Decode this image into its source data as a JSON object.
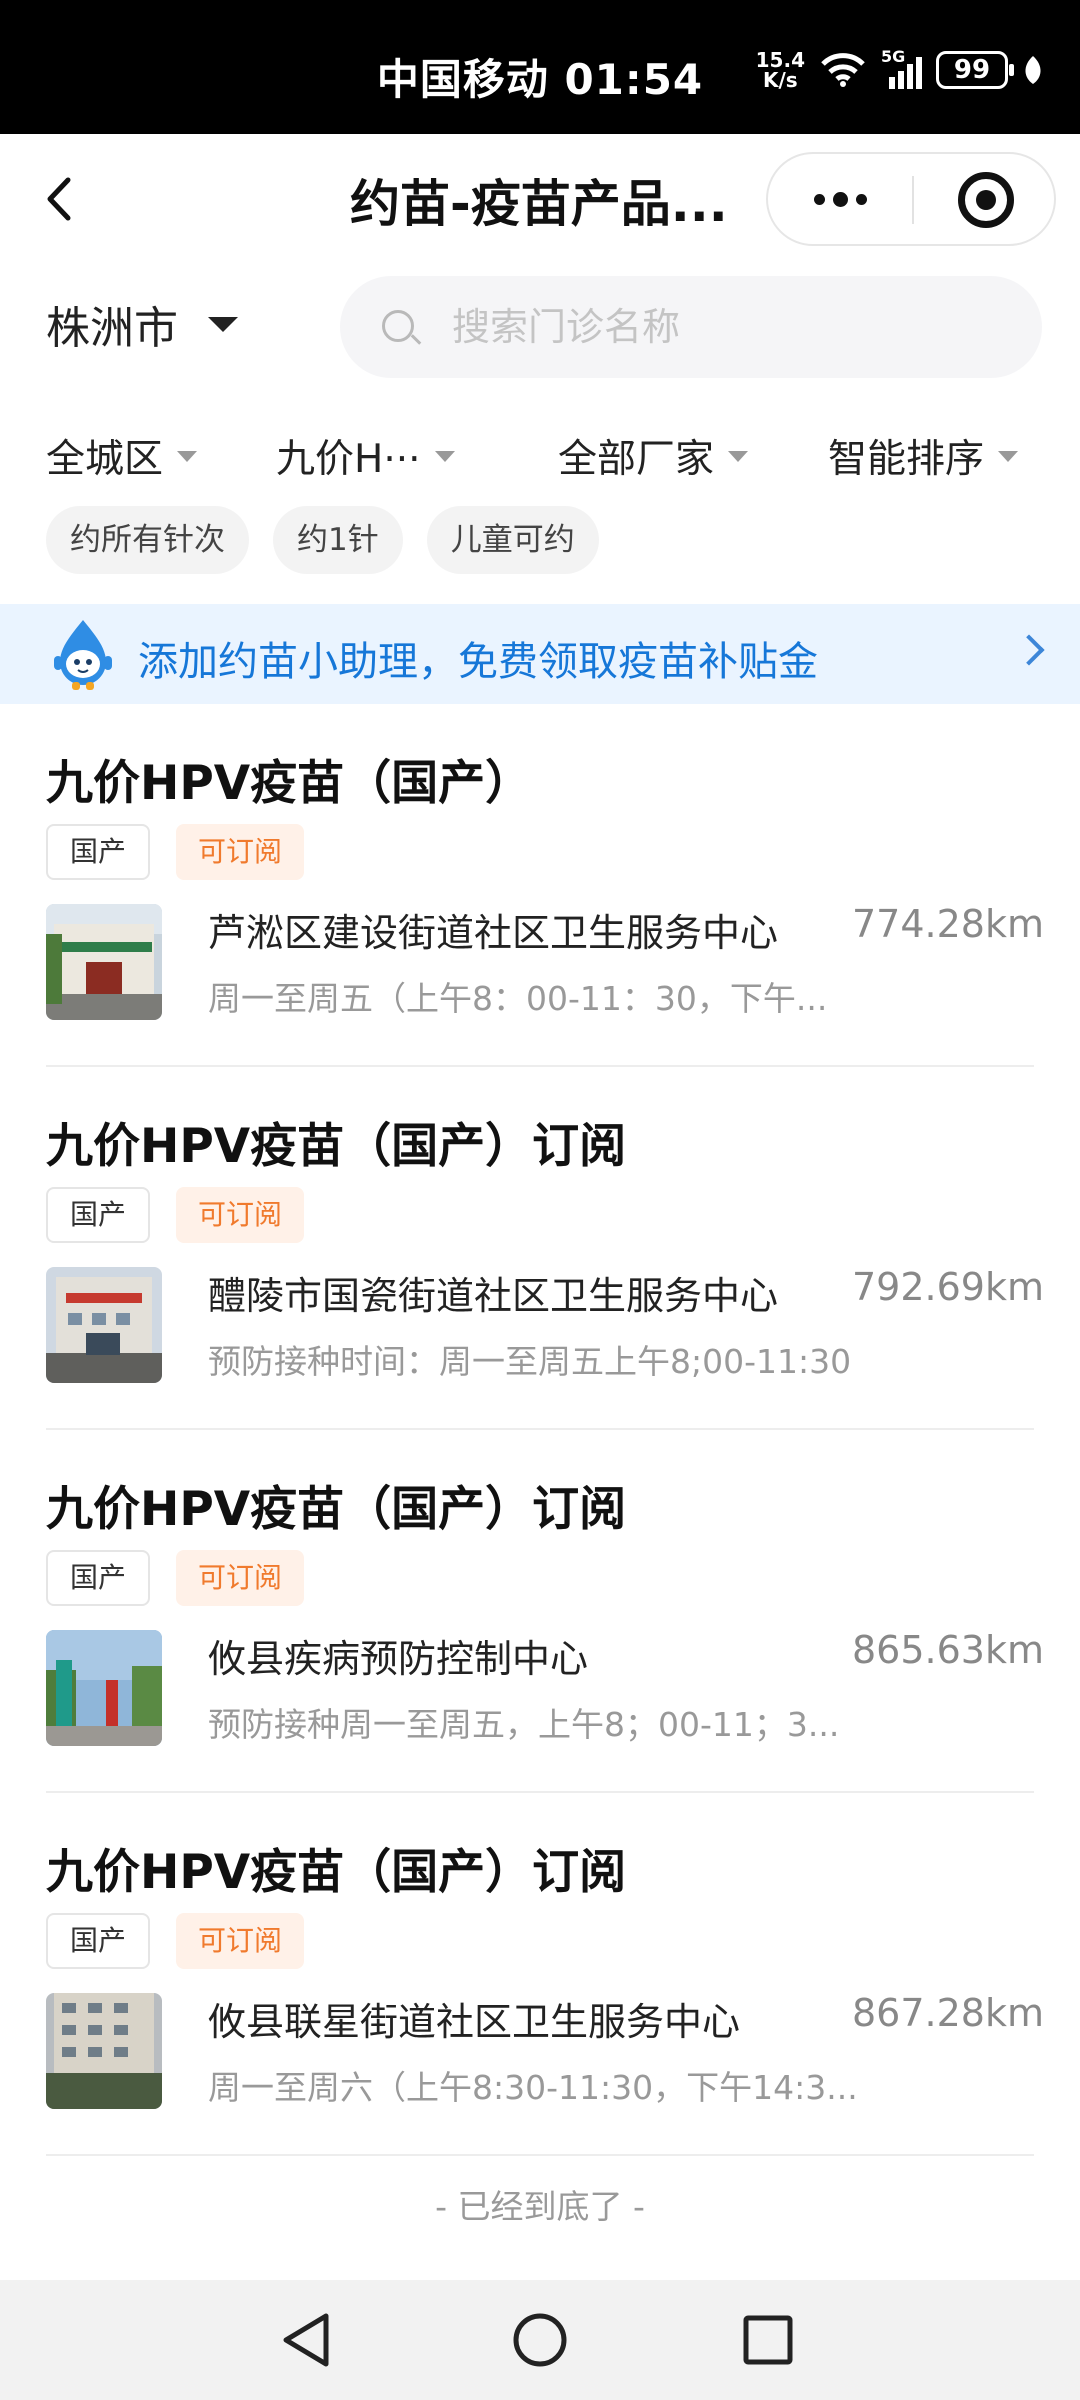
{
  "status_bar": {
    "carrier_time": "中国移动 01:54",
    "net_speed_value": "15.4",
    "net_speed_unit": "K/s",
    "network": "5G",
    "battery": "99"
  },
  "navbar": {
    "title": "约苗-疫苗产品..."
  },
  "location": {
    "city": "株洲市"
  },
  "search": {
    "placeholder": "搜索门诊名称"
  },
  "filters": [
    {
      "label": "全城区"
    },
    {
      "label": "九价H···"
    },
    {
      "label": "全部厂家"
    },
    {
      "label": "智能排序"
    }
  ],
  "chips": [
    "约所有针次",
    "约1针",
    "儿童可约"
  ],
  "banner": {
    "text": "添加约苗小助理，免费领取疫苗补贴金"
  },
  "cards": [
    {
      "title": "九价HPV疫苗（国产）",
      "tag_domestic": "国产",
      "tag_subscribe": "可订阅",
      "clinic": "芦淞区建设街道社区卫生服务中心",
      "distance": "774.28km",
      "hours": "周一至周五（上午8：00-11：30，下午..."
    },
    {
      "title": "九价HPV疫苗（国产）订阅",
      "tag_domestic": "国产",
      "tag_subscribe": "可订阅",
      "clinic": "醴陵市国瓷街道社区卫生服务中心",
      "distance": "792.69km",
      "hours": "预防接种时间：周一至周五上午8;00-11:30"
    },
    {
      "title": "九价HPV疫苗（国产）订阅",
      "tag_domestic": "国产",
      "tag_subscribe": "可订阅",
      "clinic": "攸县疾病预防控制中心",
      "distance": "865.63km",
      "hours": "预防接种周一至周五，上午8；00-11；3..."
    },
    {
      "title": "九价HPV疫苗（国产）订阅",
      "tag_domestic": "国产",
      "tag_subscribe": "可订阅",
      "clinic": "攸县联星街道社区卫生服务中心",
      "distance": "867.28km",
      "hours": "周一至周六（上午8:30-11:30，下午14:3..."
    }
  ],
  "end_text": "- 已经到底了 -",
  "colors": {
    "accent_blue": "#1677d8",
    "banner_bg": "#eaf4ff",
    "subscribe_tag": "#f07a2d",
    "subscribe_tag_bg": "#fff1e8"
  }
}
